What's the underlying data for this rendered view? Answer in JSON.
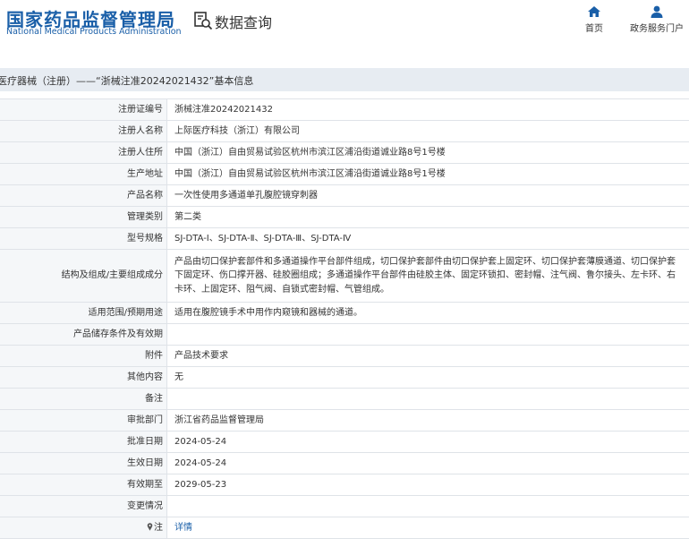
{
  "header": {
    "logo_zh": "国家药品监督管理局",
    "logo_en": "National Medical Products Administration",
    "query_title": "数据查询",
    "nav": [
      {
        "label": "首页",
        "icon": "home-icon"
      },
      {
        "label": "政务服务门户",
        "icon": "user-icon"
      }
    ]
  },
  "colors": {
    "brand_blue": "#1a5fa8",
    "band_bg": "#e7ecf2",
    "key_bg": "#f5f7f9",
    "border": "#dfe3e8"
  },
  "title_band": {
    "text": "医疗器械（注册）——“浙械注准20242021432”基本信息"
  },
  "rows": [
    {
      "key": "注册证编号",
      "value": "浙械注准20242021432"
    },
    {
      "key": "注册人名称",
      "value": "上际医疗科技（浙江）有限公司"
    },
    {
      "key": "注册人住所",
      "value": "中国（浙江）自由贸易试验区杭州市滨江区浦沿街道诚业路8号1号楼"
    },
    {
      "key": "生产地址",
      "value": "中国（浙江）自由贸易试验区杭州市滨江区浦沿街道诚业路8号1号楼"
    },
    {
      "key": "产品名称",
      "value": "一次性使用多通道单孔腹腔镜穿刺器"
    },
    {
      "key": "管理类别",
      "value": "第二类"
    },
    {
      "key": "型号规格",
      "value": "SJ-DTA-Ⅰ、SJ-DTA-Ⅱ、SJ-DTA-Ⅲ、SJ-DTA-Ⅳ"
    },
    {
      "key": "结构及组成/主要组成成分",
      "value": "产品由切口保护套部件和多通道操作平台部件组成，切口保护套部件由切口保护套上固定环、切口保护套薄膜通道、切口保护套下固定环、伤口撑开器、硅胶圈组成；多通道操作平台部件由硅胶主体、固定环锁扣、密封帽、注气阀、鲁尔接头、左卡环、右卡环、上固定环、阻气阀、自锁式密封帽、气管组成。"
    },
    {
      "key": "适用范围/预期用途",
      "value": "适用在腹腔镜手术中用作内窥镜和器械的通道。"
    },
    {
      "key": "产品储存条件及有效期",
      "value": ""
    },
    {
      "key": "附件",
      "value": "产品技术要求"
    },
    {
      "key": "其他内容",
      "value": "无"
    },
    {
      "key": "备注",
      "value": ""
    },
    {
      "key": "审批部门",
      "value": "浙江省药品监督管理局"
    },
    {
      "key": "批准日期",
      "value": "2024-05-24"
    },
    {
      "key": "生效日期",
      "value": "2024-05-24"
    },
    {
      "key": "有效期至",
      "value": "2029-05-23"
    },
    {
      "key": "变更情况",
      "value": ""
    },
    {
      "key": "注",
      "value": "详情",
      "key_icon": "pin-icon"
    }
  ]
}
